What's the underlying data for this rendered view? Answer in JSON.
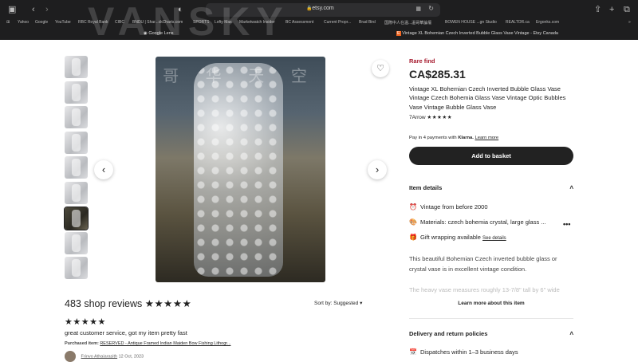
{
  "browser": {
    "url": "etsy.com",
    "watermark": "VANSKY",
    "bookmarks": [
      "Yahoo",
      "Google",
      "YouTube",
      "RBC Royal Bank",
      "CIBC",
      "BNDU | Shar...ckCharts.com",
      "SPORTS",
      "Lofty Max",
      "Marketwatch Insider",
      "BC Assessment",
      "Current Propr...",
      "Brad Bird",
      "国際中人在温...溫哥華論壇",
      "BOWEN HOUSE ...gn Studio",
      "REALTOR.ca",
      "Ergonks.com"
    ],
    "tabs": [
      "Google Lens",
      "Vintage XL Bohemian Czech Inverted Bubble Glass Vase Vintage - Etsy Canada"
    ]
  },
  "gallery": {
    "image_watermark": "哥 华 天 空",
    "thumbnail_count": 9,
    "selected_thumbnail": 7
  },
  "reviews": {
    "heading": "483 shop reviews",
    "rating_stars": "★★★★★",
    "sort_label": "Sort by: Suggested",
    "review": {
      "stars": "★★★★★",
      "text": "great customer service, got my item pretty fast",
      "purchased_label": "Purchased item:",
      "purchased_item": "RESERVED - Antique Framed Indian Maiden Bow Fishing Lithogr...",
      "reviewer": "Frinvo Athaiarasith",
      "date": "12 Oct, 2023"
    }
  },
  "listing": {
    "badge": "Rare find",
    "price": "CA$285.31",
    "title": "Vintage XL Bohemian Czech Inverted Bubble Glass Vase Vintage Czech Bohemia Glass Vase Vintage Optic Bubbles Vase Vintage Bubble Glass Vase",
    "shop_name": "7Arrow",
    "shop_stars": "★★★★★",
    "payment_text": "Pay in 4 payments with",
    "payment_brand": "Klarna.",
    "payment_link": "Learn more",
    "basket_button": "Add to basket"
  },
  "item_details": {
    "heading": "Item details",
    "vintage": "Vintage from before 2000",
    "materials": "Materials: czech bohemia crystal, large glass ...",
    "gift": "Gift wrapping available",
    "gift_link": "See details",
    "description": "This beautiful Bohemian Czech inverted bubble glass or crystal vase is in excellent vintage condition.",
    "description_faded": "The heavy vase measures roughly 13-7/8\" tall by 6\" wide",
    "learn_more": "Learn more about this item"
  },
  "delivery": {
    "heading": "Delivery and return policies",
    "dispatch": "Dispatches within 1–3 business days"
  }
}
